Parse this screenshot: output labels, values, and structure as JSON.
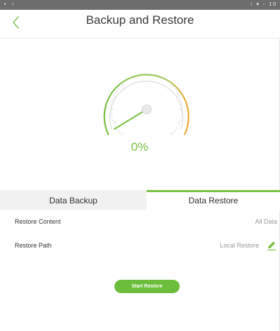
{
  "statusbar": {
    "left_icons": "• ↑",
    "right_icons": "⁝ ▾ ◦ 10"
  },
  "header": {
    "title": "Backup and Restore",
    "back_icon": "chevron-left-icon"
  },
  "progress": {
    "label": "0%",
    "value": 0
  },
  "tabs": [
    {
      "label": "Data Backup",
      "selected": false
    },
    {
      "label": "Data Restore",
      "selected": true
    }
  ],
  "restore": {
    "content_label": "Restore Content",
    "content_value": "All Data",
    "path_label": "Restore Path",
    "path_value": "Local Restore",
    "edit_icon": "pencil-icon"
  },
  "actions": {
    "start_label": "Start Restore"
  },
  "colors": {
    "accent": "#7ac143",
    "button": "#6cbd3c",
    "gauge_end": "#f0a93a",
    "text": "#333333",
    "muted": "#9a9a9a"
  }
}
